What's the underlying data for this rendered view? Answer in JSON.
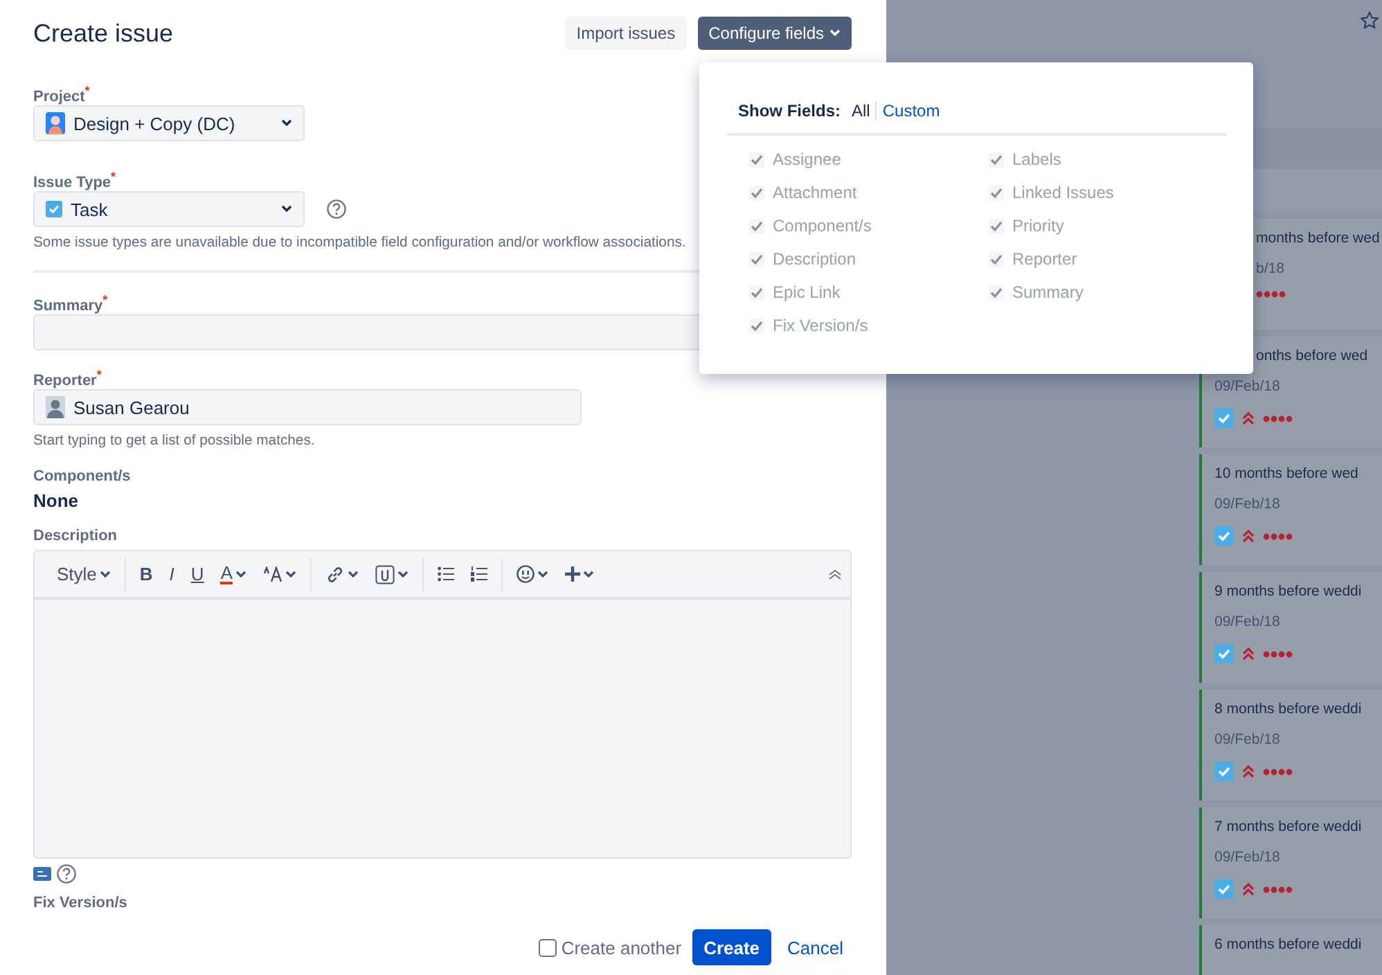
{
  "dialog": {
    "title": "Create issue",
    "header_buttons": [
      {
        "label": "Import issues",
        "kind": "secondary"
      },
      {
        "label": "Configure fields",
        "kind": "primary",
        "dropdown": true
      }
    ]
  },
  "project": {
    "label": "Project$^{*}$",
    "value": "Design + Copy (DC)"
  },
  "issue_type": {
    "label": "Issue Type$^{*}$",
    "value": "Task",
    "note": "Some issue types are unavailable due to incompatible field configuration and/or workflow associations."
  },
  "summary": {
    "label": "Summary$^{*}$"
  },
  "reporter": {
    "label": "Reporter$^{*}$",
    "value": "Susan Gearou",
    "hint": "Start typing to get a list of possible matches."
  },
  "components": {
    "label": "Component/s",
    "value": "None"
  },
  "description": {
    "label": "Description",
    "toolbar": [
      [
        {
          "kind": "text",
          "label": "Style",
          "dropdown": true
        }
      ],
      [
        {
          "kind": "bold",
          "label": "B"
        },
        {
          "kind": "italic",
          "label": "I"
        },
        {
          "kind": "underline",
          "label": "U"
        },
        {
          "kind": "color",
          "label": "A",
          "dropdown": true
        },
        {
          "kind": "size",
          "dropdown": true
        }
      ],
      [
        {
          "kind": "link",
          "dropdown": true
        },
        {
          "kind": "attach",
          "dropdown": true
        }
      ],
      [
        {
          "kind": "bullets"
        },
        {
          "kind": "numbers"
        }
      ],
      [
        {
          "kind": "emoji",
          "dropdown": true
        },
        {
          "kind": "plus",
          "dropdown": true
        }
      ]
    ]
  },
  "fix_versions": {
    "label": "Fix Version/s"
  },
  "footer": {
    "create_another": {
      "label": "Create another",
      "checked": false
    },
    "submit": "Create",
    "cancel": "Cancel"
  },
  "show_fields": {
    "label": "Show Fields:",
    "modes": [
      {
        "label": "All",
        "selected": true
      },
      {
        "label": "Custom",
        "selected": false
      }
    ],
    "fields": [
      {
        "label": "Assignee",
        "checked": true
      },
      {
        "label": "Attachment",
        "checked": true
      },
      {
        "label": "Component/s",
        "checked": true
      },
      {
        "label": "Description",
        "checked": true
      },
      {
        "label": "Epic Link",
        "checked": true
      },
      {
        "label": "Fix Version/s",
        "checked": true
      },
      {
        "label": "Labels",
        "checked": true
      },
      {
        "label": "Linked Issues",
        "checked": true
      },
      {
        "label": "Priority",
        "checked": true
      },
      {
        "label": "Reporter",
        "checked": true
      },
      {
        "label": "Summary",
        "checked": true
      }
    ]
  },
  "board_cards": [
    {
      "title": "months before wed",
      "title_covered": true,
      "date": "b/18",
      "date_covered": true,
      "show_type_icons": false
    },
    {
      "title": "onths before wed",
      "title_covered": true,
      "date": "09/Feb/18",
      "date_covered": false,
      "show_type_icons": true
    },
    {
      "title": "10 months before wed",
      "title_covered": false,
      "date": "09/Feb/18",
      "date_covered": false,
      "show_type_icons": true
    },
    {
      "title": "9 months before weddi",
      "title_covered": false,
      "date": "09/Feb/18",
      "date_covered": false,
      "show_type_icons": true
    },
    {
      "title": "8 months before weddi",
      "title_covered": false,
      "date": "09/Feb/18",
      "date_covered": false,
      "show_type_icons": true
    },
    {
      "title": "7 months before weddi",
      "title_covered": false,
      "date": "09/Feb/18",
      "date_covered": false,
      "show_type_icons": true
    },
    {
      "title": "6 months before weddi",
      "title_covered": false
    }
  ]
}
